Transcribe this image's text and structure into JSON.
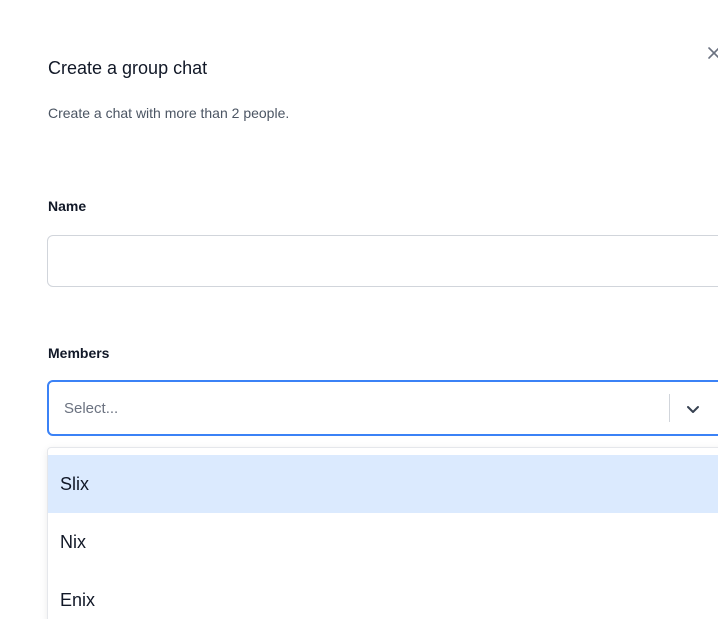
{
  "dialog": {
    "title": "Create a group chat",
    "subtitle": "Create a chat with more than 2 people.",
    "close_icon": "close-icon"
  },
  "form": {
    "name": {
      "label": "Name",
      "value": "",
      "placeholder": ""
    },
    "members": {
      "label": "Members",
      "placeholder": "Select...",
      "chevron_icon": "chevron-down-icon",
      "options": [
        {
          "label": "Slix",
          "highlighted": true
        },
        {
          "label": "Nix",
          "highlighted": false
        },
        {
          "label": "Enix",
          "highlighted": false
        }
      ]
    }
  },
  "colors": {
    "focus_border": "#3b82f6",
    "highlight": "#dbeafe",
    "border": "#d1d5db",
    "muted_text": "#6b7280"
  }
}
